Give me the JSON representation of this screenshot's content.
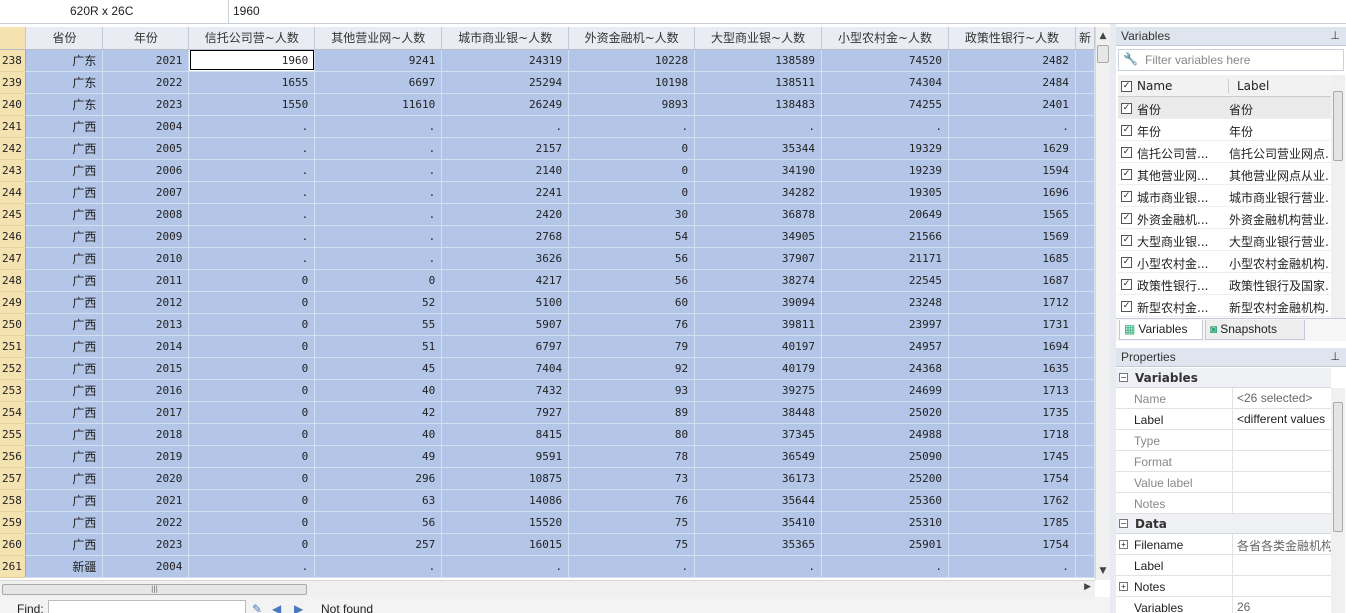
{
  "topbar": {
    "dims": "620R x 26C",
    "cell_value": "1960"
  },
  "grid": {
    "columns": [
      "省份",
      "年份",
      "信托公司营~人数",
      "其他营业网~人数",
      "城市商业银~人数",
      "外资金融机~人数",
      "大型商业银~人数",
      "小型农村金~人数",
      "政策性银行~人数",
      "新"
    ],
    "rows": [
      [
        "238",
        "广东",
        "2021",
        "1960",
        "9241",
        "24319",
        "10228",
        "138589",
        "74520",
        "2482"
      ],
      [
        "239",
        "广东",
        "2022",
        "1655",
        "6697",
        "25294",
        "10198",
        "138511",
        "74304",
        "2484"
      ],
      [
        "240",
        "广东",
        "2023",
        "1550",
        "11610",
        "26249",
        "9893",
        "138483",
        "74255",
        "2401"
      ],
      [
        "241",
        "广西",
        "2004",
        ".",
        ".",
        ".",
        ".",
        ".",
        ".",
        "."
      ],
      [
        "242",
        "广西",
        "2005",
        ".",
        ".",
        "2157",
        "0",
        "35344",
        "19329",
        "1629"
      ],
      [
        "243",
        "广西",
        "2006",
        ".",
        ".",
        "2140",
        "0",
        "34190",
        "19239",
        "1594"
      ],
      [
        "244",
        "广西",
        "2007",
        ".",
        ".",
        "2241",
        "0",
        "34282",
        "19305",
        "1696"
      ],
      [
        "245",
        "广西",
        "2008",
        ".",
        ".",
        "2420",
        "30",
        "36878",
        "20649",
        "1565"
      ],
      [
        "246",
        "广西",
        "2009",
        ".",
        ".",
        "2768",
        "54",
        "34905",
        "21566",
        "1569"
      ],
      [
        "247",
        "广西",
        "2010",
        ".",
        ".",
        "3626",
        "56",
        "37907",
        "21171",
        "1685"
      ],
      [
        "248",
        "广西",
        "2011",
        "0",
        "0",
        "4217",
        "56",
        "38274",
        "22545",
        "1687"
      ],
      [
        "249",
        "广西",
        "2012",
        "0",
        "52",
        "5100",
        "60",
        "39094",
        "23248",
        "1712"
      ],
      [
        "250",
        "广西",
        "2013",
        "0",
        "55",
        "5907",
        "76",
        "39811",
        "23997",
        "1731"
      ],
      [
        "251",
        "广西",
        "2014",
        "0",
        "51",
        "6797",
        "79",
        "40197",
        "24957",
        "1694"
      ],
      [
        "252",
        "广西",
        "2015",
        "0",
        "45",
        "7404",
        "92",
        "40179",
        "24368",
        "1635"
      ],
      [
        "253",
        "广西",
        "2016",
        "0",
        "40",
        "7432",
        "93",
        "39275",
        "24699",
        "1713"
      ],
      [
        "254",
        "广西",
        "2017",
        "0",
        "42",
        "7927",
        "89",
        "38448",
        "25020",
        "1735"
      ],
      [
        "255",
        "广西",
        "2018",
        "0",
        "40",
        "8415",
        "80",
        "37345",
        "24988",
        "1718"
      ],
      [
        "256",
        "广西",
        "2019",
        "0",
        "49",
        "9591",
        "78",
        "36549",
        "25090",
        "1745"
      ],
      [
        "257",
        "广西",
        "2020",
        "0",
        "296",
        "10875",
        "73",
        "36173",
        "25200",
        "1754"
      ],
      [
        "258",
        "广西",
        "2021",
        "0",
        "63",
        "14086",
        "76",
        "35644",
        "25360",
        "1762"
      ],
      [
        "259",
        "广西",
        "2022",
        "0",
        "56",
        "15520",
        "75",
        "35410",
        "25310",
        "1785"
      ],
      [
        "260",
        "广西",
        "2023",
        "0",
        "257",
        "16015",
        "75",
        "35365",
        "25901",
        "1754"
      ],
      [
        "261",
        "新疆",
        "2004",
        ".",
        ".",
        ".",
        ".",
        ".",
        ".",
        "."
      ]
    ]
  },
  "findbar": {
    "label": "Find:",
    "status": "Not found"
  },
  "variables_panel": {
    "title": "Variables",
    "filter_placeholder": "Filter variables here",
    "col_name": "Name",
    "col_label": "Label",
    "items": [
      {
        "name": "省份",
        "label": "省份"
      },
      {
        "name": "年份",
        "label": "年份"
      },
      {
        "name": "信托公司营...",
        "label": "信托公司营业网点..."
      },
      {
        "name": "其他营业网...",
        "label": "其他营业网点从业..."
      },
      {
        "name": "城市商业银...",
        "label": "城市商业银行营业..."
      },
      {
        "name": "外资金融机...",
        "label": "外资金融机构营业..."
      },
      {
        "name": "大型商业银...",
        "label": "大型商业银行营业..."
      },
      {
        "name": "小型农村金...",
        "label": "小型农村金融机构..."
      },
      {
        "name": "政策性银行...",
        "label": "政策性银行及国家..."
      },
      {
        "name": "新型农村金...",
        "label": "新型农村金融机构..."
      }
    ],
    "tab_variables": "Variables",
    "tab_snapshots": "Snapshots"
  },
  "properties_panel": {
    "title": "Properties",
    "section_variables": "Variables",
    "var_rows": [
      {
        "key": "Name",
        "value": "<26 selected>"
      },
      {
        "key": "Label",
        "value": "<different values"
      },
      {
        "key": "Type",
        "value": ""
      },
      {
        "key": "Format",
        "value": ""
      },
      {
        "key": "Value label",
        "value": ""
      },
      {
        "key": "Notes",
        "value": ""
      }
    ],
    "section_data": "Data",
    "data_rows": [
      {
        "key": "Filename",
        "value": "各省各类金融机构"
      },
      {
        "key": "Label",
        "value": ""
      },
      {
        "key": "Notes",
        "value": ""
      },
      {
        "key": "Variables",
        "value": "26"
      }
    ]
  }
}
